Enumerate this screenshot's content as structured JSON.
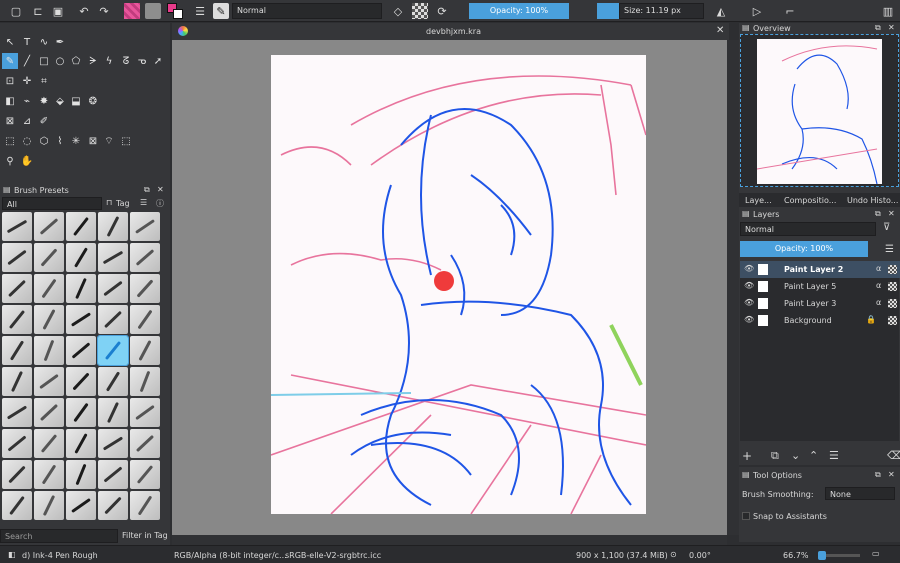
{
  "toolbar": {
    "blend_mode": "Normal",
    "opacity": "Opacity: 100%",
    "size": "Size: 11.19 px"
  },
  "document": {
    "title": "devbhjxm.kra"
  },
  "brush_presets": {
    "title": "Brush Presets",
    "filter": "All",
    "tag": "Tag",
    "search_placeholder": "Search",
    "filter_in_tag": "Filter in Tag",
    "current": "d) Ink-4 Pen Rough"
  },
  "overview": {
    "title": "Overview"
  },
  "tabs": [
    "Laye...",
    "Compositio...",
    "Undo Histo..."
  ],
  "layers": {
    "title": "Layers",
    "blend": "Normal",
    "opacity": "Opacity: 100%",
    "items": [
      {
        "name": "Paint Layer 2"
      },
      {
        "name": "Paint Layer 5"
      },
      {
        "name": "Paint Layer 3"
      },
      {
        "name": "Background"
      }
    ]
  },
  "tool_options": {
    "title": "Tool Options",
    "smoothing_label": "Brush Smoothing:",
    "smoothing_value": "None",
    "snap_label": "Snap to Assistants"
  },
  "status": {
    "color_mode": "RGB/Alpha (8-bit integer/c...",
    "profile": "sRGB-elle-V2-srgbtrc.icc",
    "dims": "900 x 1,100 (37.4 MiB)",
    "rotation": "0.00°",
    "zoom": "66.7%"
  },
  "colors": {
    "accent": "#4aa0dc",
    "fg": "#e83a8a",
    "bg": "#8e8e8e"
  }
}
